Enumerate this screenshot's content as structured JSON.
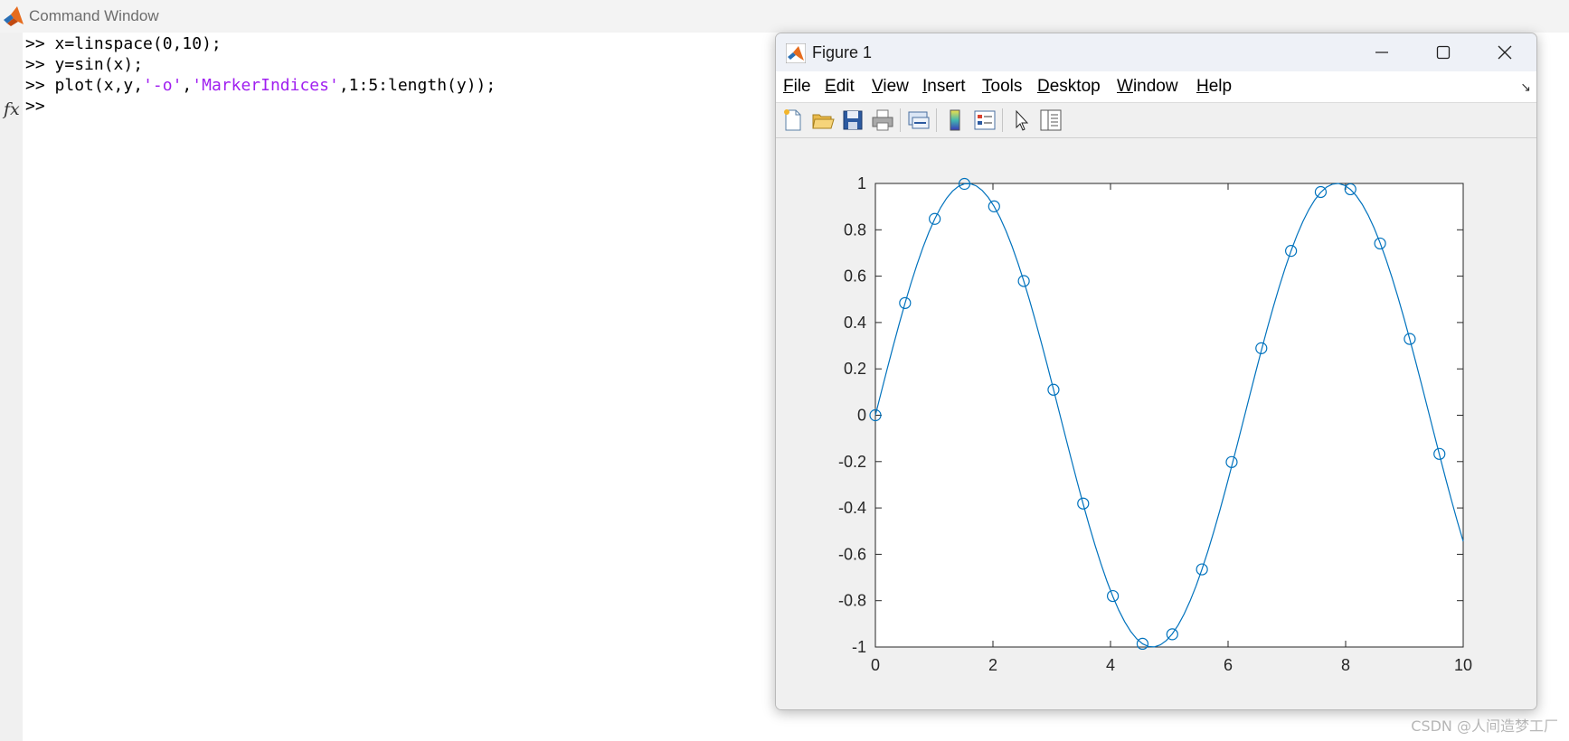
{
  "command_window": {
    "title": "Command Window",
    "fx_label": "fx",
    "lines": [
      {
        "prompt": ">> ",
        "code": "x=linspace(0,10);"
      },
      {
        "prompt": ">> ",
        "code": "y=sin(x);"
      },
      {
        "prompt": ">> ",
        "code_parts": [
          "plot(x,y,",
          "'-o'",
          ",",
          "'MarkerIndices'",
          ",1:5:length(y));"
        ]
      },
      {
        "prompt": ">>",
        "code": ""
      }
    ]
  },
  "figure": {
    "title": "Figure 1",
    "window_buttons": {
      "minimize": "minimize-icon",
      "maximize": "maximize-icon",
      "close": "close-icon"
    },
    "menu": [
      {
        "label": "File",
        "mnemonic": "F",
        "rest": "ile"
      },
      {
        "label": "Edit",
        "mnemonic": "E",
        "rest": "dit"
      },
      {
        "label": "View",
        "mnemonic": "V",
        "rest": "iew"
      },
      {
        "label": "Insert",
        "mnemonic": "I",
        "rest": "nsert"
      },
      {
        "label": "Tools",
        "mnemonic": "T",
        "rest": "ools"
      },
      {
        "label": "Desktop",
        "mnemonic": "D",
        "rest": "esktop"
      },
      {
        "label": "Window",
        "mnemonic": "W",
        "rest": "indow"
      },
      {
        "label": "Help",
        "mnemonic": "H",
        "rest": "elp"
      }
    ],
    "toolbar": [
      "new-figure-icon",
      "open-file-icon",
      "save-icon",
      "print-icon",
      "link-plot-icon",
      "insert-colorbar-icon",
      "insert-legend-icon",
      "edit-plot-icon",
      "property-inspector-icon"
    ]
  },
  "chart_data": {
    "type": "line",
    "function": "sin(x)",
    "x_range": [
      0,
      10
    ],
    "xlim": [
      0,
      10
    ],
    "ylim": [
      -1,
      1
    ],
    "x_ticks": [
      "0",
      "2",
      "4",
      "6",
      "8",
      "10"
    ],
    "y_ticks": [
      "1",
      "0.8",
      "0.6",
      "0.4",
      "0.2",
      "0",
      "-0.2",
      "-0.4",
      "-0.6",
      "-0.8",
      "-1"
    ],
    "series": [
      {
        "line_style": "-o",
        "color": "#0072bd",
        "line_samples": 100,
        "marker_indices_step": 5,
        "markers_x": [
          0,
          0.505,
          1.01,
          1.515,
          2.02,
          2.525,
          3.03,
          3.535,
          4.04,
          4.545,
          5.051,
          5.556,
          6.061,
          6.566,
          7.071,
          7.576,
          8.081,
          8.586,
          9.091,
          9.596
        ],
        "markers_y": [
          0,
          0.484,
          0.847,
          0.998,
          0.901,
          0.579,
          0.11,
          -0.381,
          -0.78,
          -0.986,
          -0.945,
          -0.665,
          -0.202,
          0.289,
          0.709,
          0.963,
          0.975,
          0.741,
          0.329,
          -0.167
        ]
      }
    ],
    "grid": false
  },
  "watermark": "CSDN @人间造梦工厂",
  "colors": {
    "matlab_orange": "#e66c1e",
    "plot_blue": "#0072bd",
    "string_purple": "#a020f0"
  }
}
